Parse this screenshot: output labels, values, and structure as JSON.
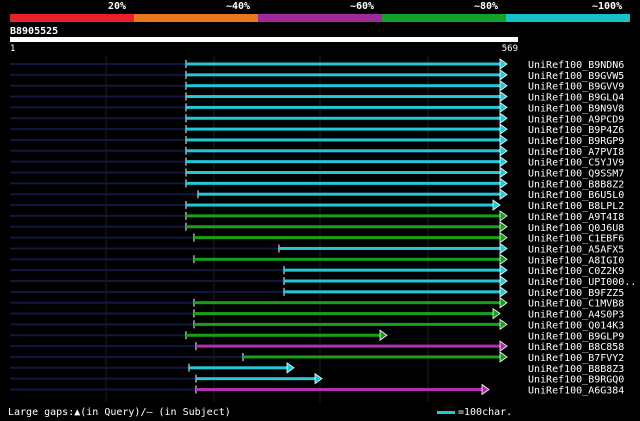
{
  "legend": [
    {
      "label": "20%",
      "color": "#e8202a"
    },
    {
      "label": "~40%",
      "color": "#e67820"
    },
    {
      "label": "~60%",
      "color": "#a0289c"
    },
    {
      "label": "~80%",
      "color": "#16a028"
    },
    {
      "label": "~100%",
      "color": "#18c0c8"
    }
  ],
  "query": {
    "id": "B8905525",
    "start": "1",
    "end": "569"
  },
  "colors": {
    "cyan": "#22c8d8",
    "green": "#18a018",
    "magenta": "#b030b0",
    "grid": "#202020",
    "shadow": "#101840"
  },
  "hits": [
    {
      "label": "UniRef100_B9NDN6",
      "color": "cyan",
      "start": 186,
      "end": 500
    },
    {
      "label": "UniRef100_B9GVW5",
      "color": "cyan",
      "start": 186,
      "end": 500
    },
    {
      "label": "UniRef100_B9GVV9",
      "color": "cyan",
      "start": 186,
      "end": 500
    },
    {
      "label": "UniRef100_B9GLQ4",
      "color": "cyan",
      "start": 186,
      "end": 500
    },
    {
      "label": "UniRef100_B9N9V8",
      "color": "cyan",
      "start": 186,
      "end": 500
    },
    {
      "label": "UniRef100_A9PCD9",
      "color": "cyan",
      "start": 186,
      "end": 500
    },
    {
      "label": "UniRef100_B9P4Z6",
      "color": "cyan",
      "start": 186,
      "end": 500
    },
    {
      "label": "UniRef100_B9RGP9",
      "color": "cyan",
      "start": 186,
      "end": 500
    },
    {
      "label": "UniRef100_A7PVI8",
      "color": "cyan",
      "start": 186,
      "end": 500
    },
    {
      "label": "UniRef100_C5YJV9",
      "color": "cyan",
      "start": 186,
      "end": 500
    },
    {
      "label": "UniRef100_Q9SSM7",
      "color": "cyan",
      "start": 186,
      "end": 500
    },
    {
      "label": "UniRef100_B8B8Z2",
      "color": "cyan",
      "start": 186,
      "end": 500
    },
    {
      "label": "UniRef100_B6U5L0",
      "color": "cyan",
      "start": 198,
      "end": 500
    },
    {
      "label": "UniRef100_B8LPL2",
      "color": "cyan",
      "start": 186,
      "end": 493
    },
    {
      "label": "UniRef100_A9T4I8",
      "color": "green",
      "start": 186,
      "end": 500
    },
    {
      "label": "UniRef100_Q0J6U8",
      "color": "green",
      "start": 186,
      "end": 500
    },
    {
      "label": "UniRef100_C1EBF6",
      "color": "green",
      "start": 194,
      "end": 500
    },
    {
      "label": "UniRef100_A5AFX5",
      "color": "cyan",
      "start": 279,
      "end": 500
    },
    {
      "label": "UniRef100_A8IGI0",
      "color": "green",
      "start": 194,
      "end": 500
    },
    {
      "label": "UniRef100_C0Z2K9",
      "color": "cyan",
      "start": 284,
      "end": 500
    },
    {
      "label": "UniRef100_UPI000..",
      "color": "cyan",
      "start": 284,
      "end": 500
    },
    {
      "label": "UniRef100_B9FZZ5",
      "color": "cyan",
      "start": 284,
      "end": 500
    },
    {
      "label": "UniRef100_C1MVB8",
      "color": "green",
      "start": 194,
      "end": 500
    },
    {
      "label": "UniRef100_A4S0P3",
      "color": "green",
      "start": 194,
      "end": 493
    },
    {
      "label": "UniRef100_Q014K3",
      "color": "green",
      "start": 194,
      "end": 500
    },
    {
      "label": "UniRef100_B9GLP9",
      "color": "green",
      "start": 186,
      "end": 380
    },
    {
      "label": "UniRef100_B8C858",
      "color": "magenta",
      "start": 196,
      "end": 500
    },
    {
      "label": "UniRef100_B7FVY2",
      "color": "green",
      "start": 243,
      "end": 500
    },
    {
      "label": "UniRef100_B8B8Z3",
      "color": "cyan",
      "start": 189,
      "end": 287
    },
    {
      "label": "UniRef100_B9RGQ0",
      "color": "cyan",
      "start": 196,
      "end": 315
    },
    {
      "label": "UniRef100_A6G384",
      "color": "magenta",
      "start": 196,
      "end": 482
    }
  ],
  "footer": {
    "gaps_text": "Large gaps:▲(in Query)/— (in Subject)",
    "scale_text": "=100char."
  }
}
